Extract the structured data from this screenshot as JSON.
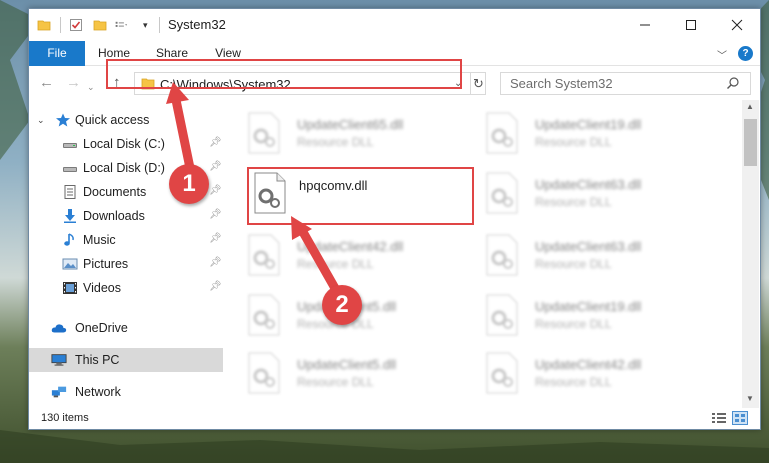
{
  "window": {
    "title": "System32",
    "controls": {
      "minimize": "minimize-icon",
      "maximize": "maximize-icon",
      "close": "close-icon"
    }
  },
  "ribbon": {
    "tabs": [
      "File",
      "Home",
      "Share",
      "View"
    ],
    "help_label": "?"
  },
  "navigation": {
    "address": "C:\\Windows\\System32",
    "search_placeholder": "Search System32"
  },
  "sidebar": {
    "items": [
      {
        "label": "Quick access",
        "icon": "star-icon",
        "pinned": false
      },
      {
        "label": "Local Disk (C:)",
        "icon": "drive-icon",
        "pinned": true
      },
      {
        "label": "Local Disk (D:)",
        "icon": "drive-icon",
        "pinned": true
      },
      {
        "label": "Documents",
        "icon": "documents-icon",
        "pinned": true
      },
      {
        "label": "Downloads",
        "icon": "download-icon",
        "pinned": true
      },
      {
        "label": "Music",
        "icon": "music-icon",
        "pinned": true
      },
      {
        "label": "Pictures",
        "icon": "pictures-icon",
        "pinned": true
      },
      {
        "label": "Videos",
        "icon": "videos-icon",
        "pinned": true
      },
      {
        "label": "OneDrive",
        "icon": "cloud-icon",
        "pinned": false
      },
      {
        "label": "This PC",
        "icon": "computer-icon",
        "pinned": false,
        "selected": true
      },
      {
        "label": "Network",
        "icon": "network-icon",
        "pinned": false
      }
    ]
  },
  "files": [
    {
      "name": "UpdateClient65.dll",
      "type": "Resource DLL",
      "blurred": true
    },
    {
      "name": "UpdateClient19.dll",
      "type": "Resource DLL",
      "blurred": true
    },
    {
      "name": "hpqcomv.dll",
      "type": "",
      "blurred": false,
      "highlighted": true
    },
    {
      "name": "UpdateClient63.dll",
      "type": "Resource DLL",
      "blurred": true
    },
    {
      "name": "UpdateClient42.dll",
      "type": "Resource DLL",
      "blurred": true
    },
    {
      "name": "UpdateClient63.dll",
      "type": "Resource DLL",
      "blurred": true
    },
    {
      "name": "UpdateClient5.dll",
      "type": "Resource DLL",
      "blurred": true
    },
    {
      "name": "UpdateClient19.dll",
      "type": "Resource DLL",
      "blurred": true
    },
    {
      "name": "UpdateClient5.dll",
      "type": "Resource DLL",
      "blurred": true
    },
    {
      "name": "UpdateClient42.dll",
      "type": "Resource DLL",
      "blurred": true
    }
  ],
  "status": {
    "item_count": "130 items"
  },
  "callouts": {
    "step1": "1",
    "step2": "2",
    "color": "#e04545"
  }
}
